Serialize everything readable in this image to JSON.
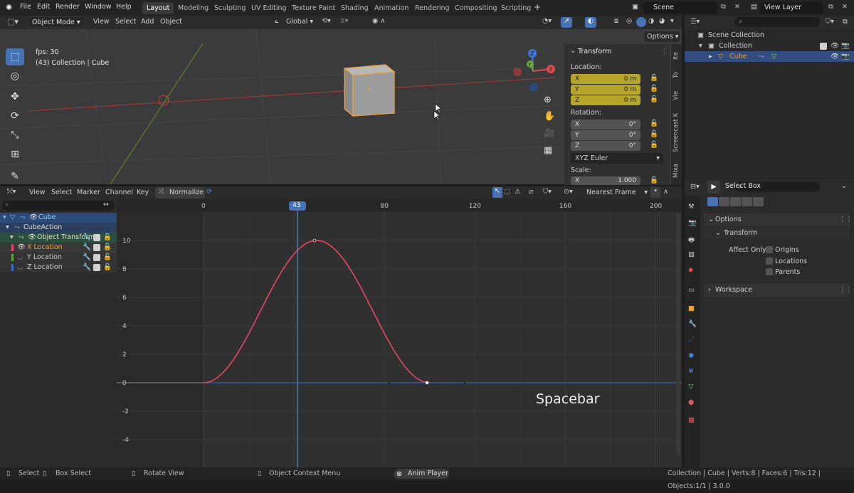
{
  "topbar": {
    "menus": [
      "File",
      "Edit",
      "Render",
      "Window",
      "Help"
    ],
    "workspaces": [
      "Layout",
      "Modeling",
      "Sculpting",
      "UV Editing",
      "Texture Paint",
      "Shading",
      "Animation",
      "Rendering",
      "Compositing",
      "Scripting"
    ],
    "active_workspace": "Layout",
    "scene": "Scene",
    "view_layer": "View Layer"
  },
  "viewport_header": {
    "mode": "Object Mode",
    "menus": [
      "View",
      "Select",
      "Add",
      "Object"
    ],
    "orientation": "Global",
    "options": "Options"
  },
  "viewport": {
    "fps": "fps: 30",
    "info": "(43) Collection | Cube"
  },
  "npanel": {
    "title": "Transform",
    "location_label": "Location:",
    "location": [
      {
        "axis": "X",
        "value": "0 m"
      },
      {
        "axis": "Y",
        "value": "0 m"
      },
      {
        "axis": "Z",
        "value": "0 m"
      }
    ],
    "rotation_label": "Rotation:",
    "rotation": [
      {
        "axis": "X",
        "value": "0°"
      },
      {
        "axis": "Y",
        "value": "0°"
      },
      {
        "axis": "Z",
        "value": "0°"
      }
    ],
    "euler": "XYZ Euler",
    "scale_label": "Scale:",
    "scale_x": {
      "axis": "X",
      "value": "1.000"
    },
    "side_tabs": [
      "Ite",
      "To",
      "Vie",
      "Screencast K",
      "Mixa"
    ]
  },
  "outliner": {
    "scene_collection": "Scene Collection",
    "collection": "Collection",
    "cube": "Cube"
  },
  "graph_header": {
    "menus": [
      "View",
      "Select",
      "Marker",
      "Channel",
      "Key"
    ],
    "normalize": "Normalize",
    "snap": "Nearest Frame"
  },
  "channels": {
    "object": "Cube",
    "action": "CubeAction",
    "group": "Object Transform",
    "curves": [
      "X Location",
      "Y Location",
      "Z Location"
    ],
    "curve_colors": [
      "#e6475f",
      "#5ca836",
      "#3a6ad1"
    ]
  },
  "graph": {
    "frame_ticks": [
      "0",
      "40",
      "80",
      "120",
      "160",
      "200"
    ],
    "current_frame": "43",
    "value_ticks": [
      "10",
      "8",
      "6",
      "4",
      "2",
      "0",
      "-2",
      "-4"
    ],
    "overlay": "Spacebar"
  },
  "properties": {
    "tool": "Select Box",
    "options": "Options",
    "transform": "Transform",
    "affect_only": "Affect Only",
    "checks": [
      "Origins",
      "Locations",
      "Parents"
    ],
    "workspace": "Workspace"
  },
  "statusbar": {
    "select": "Select",
    "box_select": "Box Select",
    "rotate_view": "Rotate View",
    "context_menu": "Object Context Menu",
    "anim_player": "Anim Player",
    "stats": "Collection | Cube | Verts:8 | Faces:6 | Tris:12 | Objects:1/1 | 3.0.0"
  }
}
